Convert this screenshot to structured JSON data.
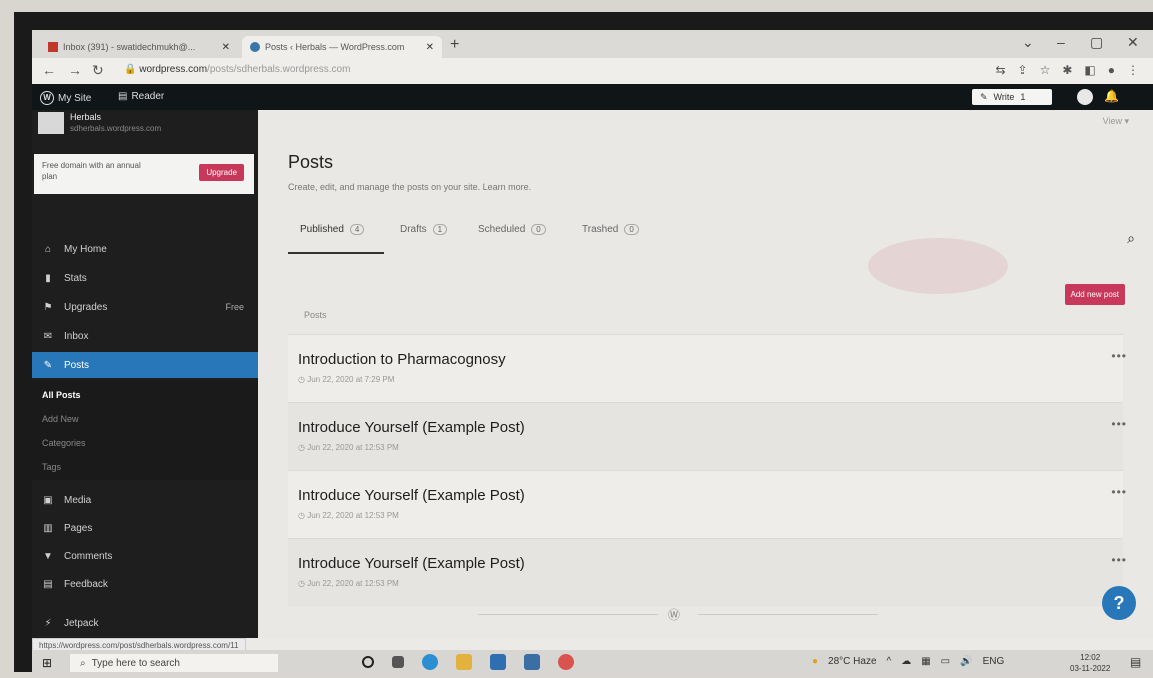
{
  "browser": {
    "tabs": [
      {
        "title": "Inbox (391) - swatidechmukh@...",
        "icon": "gmail-icon"
      },
      {
        "title": "Posts ‹ Herbals — WordPress.com",
        "icon": "wordpress-icon"
      }
    ],
    "url_host": "wordpress.com",
    "url_path": "/posts/sdherbals.wordpress.com"
  },
  "wpbar": {
    "my_site": "My Site",
    "reader": "Reader",
    "write": "Write",
    "write_count": "1"
  },
  "site": {
    "name": "Herbals",
    "url": "sdherbals.wordpress.com"
  },
  "promo": {
    "text": "Free domain with an annual plan",
    "button": "Upgrade"
  },
  "sidebar": {
    "items": [
      {
        "label": "My Home",
        "icon": "home-icon"
      },
      {
        "label": "Stats",
        "icon": "stats-icon"
      },
      {
        "label": "Upgrades",
        "icon": "upgrades-icon",
        "badge": "Free"
      },
      {
        "label": "Inbox",
        "icon": "inbox-icon"
      },
      {
        "label": "Posts",
        "icon": "pin-icon"
      }
    ],
    "submenu": [
      "All Posts",
      "Add New",
      "Categories",
      "Tags"
    ],
    "items2": [
      {
        "label": "Media",
        "icon": "media-icon"
      },
      {
        "label": "Pages",
        "icon": "pages-icon"
      },
      {
        "label": "Comments",
        "icon": "comments-icon"
      },
      {
        "label": "Feedback",
        "icon": "feedback-icon"
      },
      {
        "label": "Jetpack",
        "icon": "jetpack-icon"
      }
    ]
  },
  "main": {
    "view": "View",
    "title": "Posts",
    "subtitle": "Create, edit, and manage the posts on your site. Learn more.",
    "tabs": [
      {
        "label": "Published",
        "count": "4"
      },
      {
        "label": "Drafts",
        "count": "1"
      },
      {
        "label": "Scheduled",
        "count": "0"
      },
      {
        "label": "Trashed",
        "count": "0"
      }
    ],
    "add_new": "Add new post",
    "list_header": "Posts",
    "posts": [
      {
        "title": "Introduction to Pharmacognosy",
        "date": "Jun 22, 2020 at 7:29 PM"
      },
      {
        "title": "Introduce Yourself (Example Post)",
        "date": "Jun 22, 2020 at 12:53 PM"
      },
      {
        "title": "Introduce Yourself (Example Post)",
        "date": "Jun 22, 2020 at 12:53 PM"
      },
      {
        "title": "Introduce Yourself (Example Post)",
        "date": "Jun 22, 2020 at 12:53 PM"
      }
    ]
  },
  "status_url": "https://wordpress.com/post/sdherbals.wordpress.com/11",
  "taskbar": {
    "search": "Type here to search",
    "weather": "28°C  Haze",
    "lang": "ENG",
    "time": "12:02",
    "date": "03-11-2022"
  },
  "colors": {
    "accent": "#2877b8",
    "pink": "#c8385a",
    "sidebar": "#1e1e1e"
  }
}
